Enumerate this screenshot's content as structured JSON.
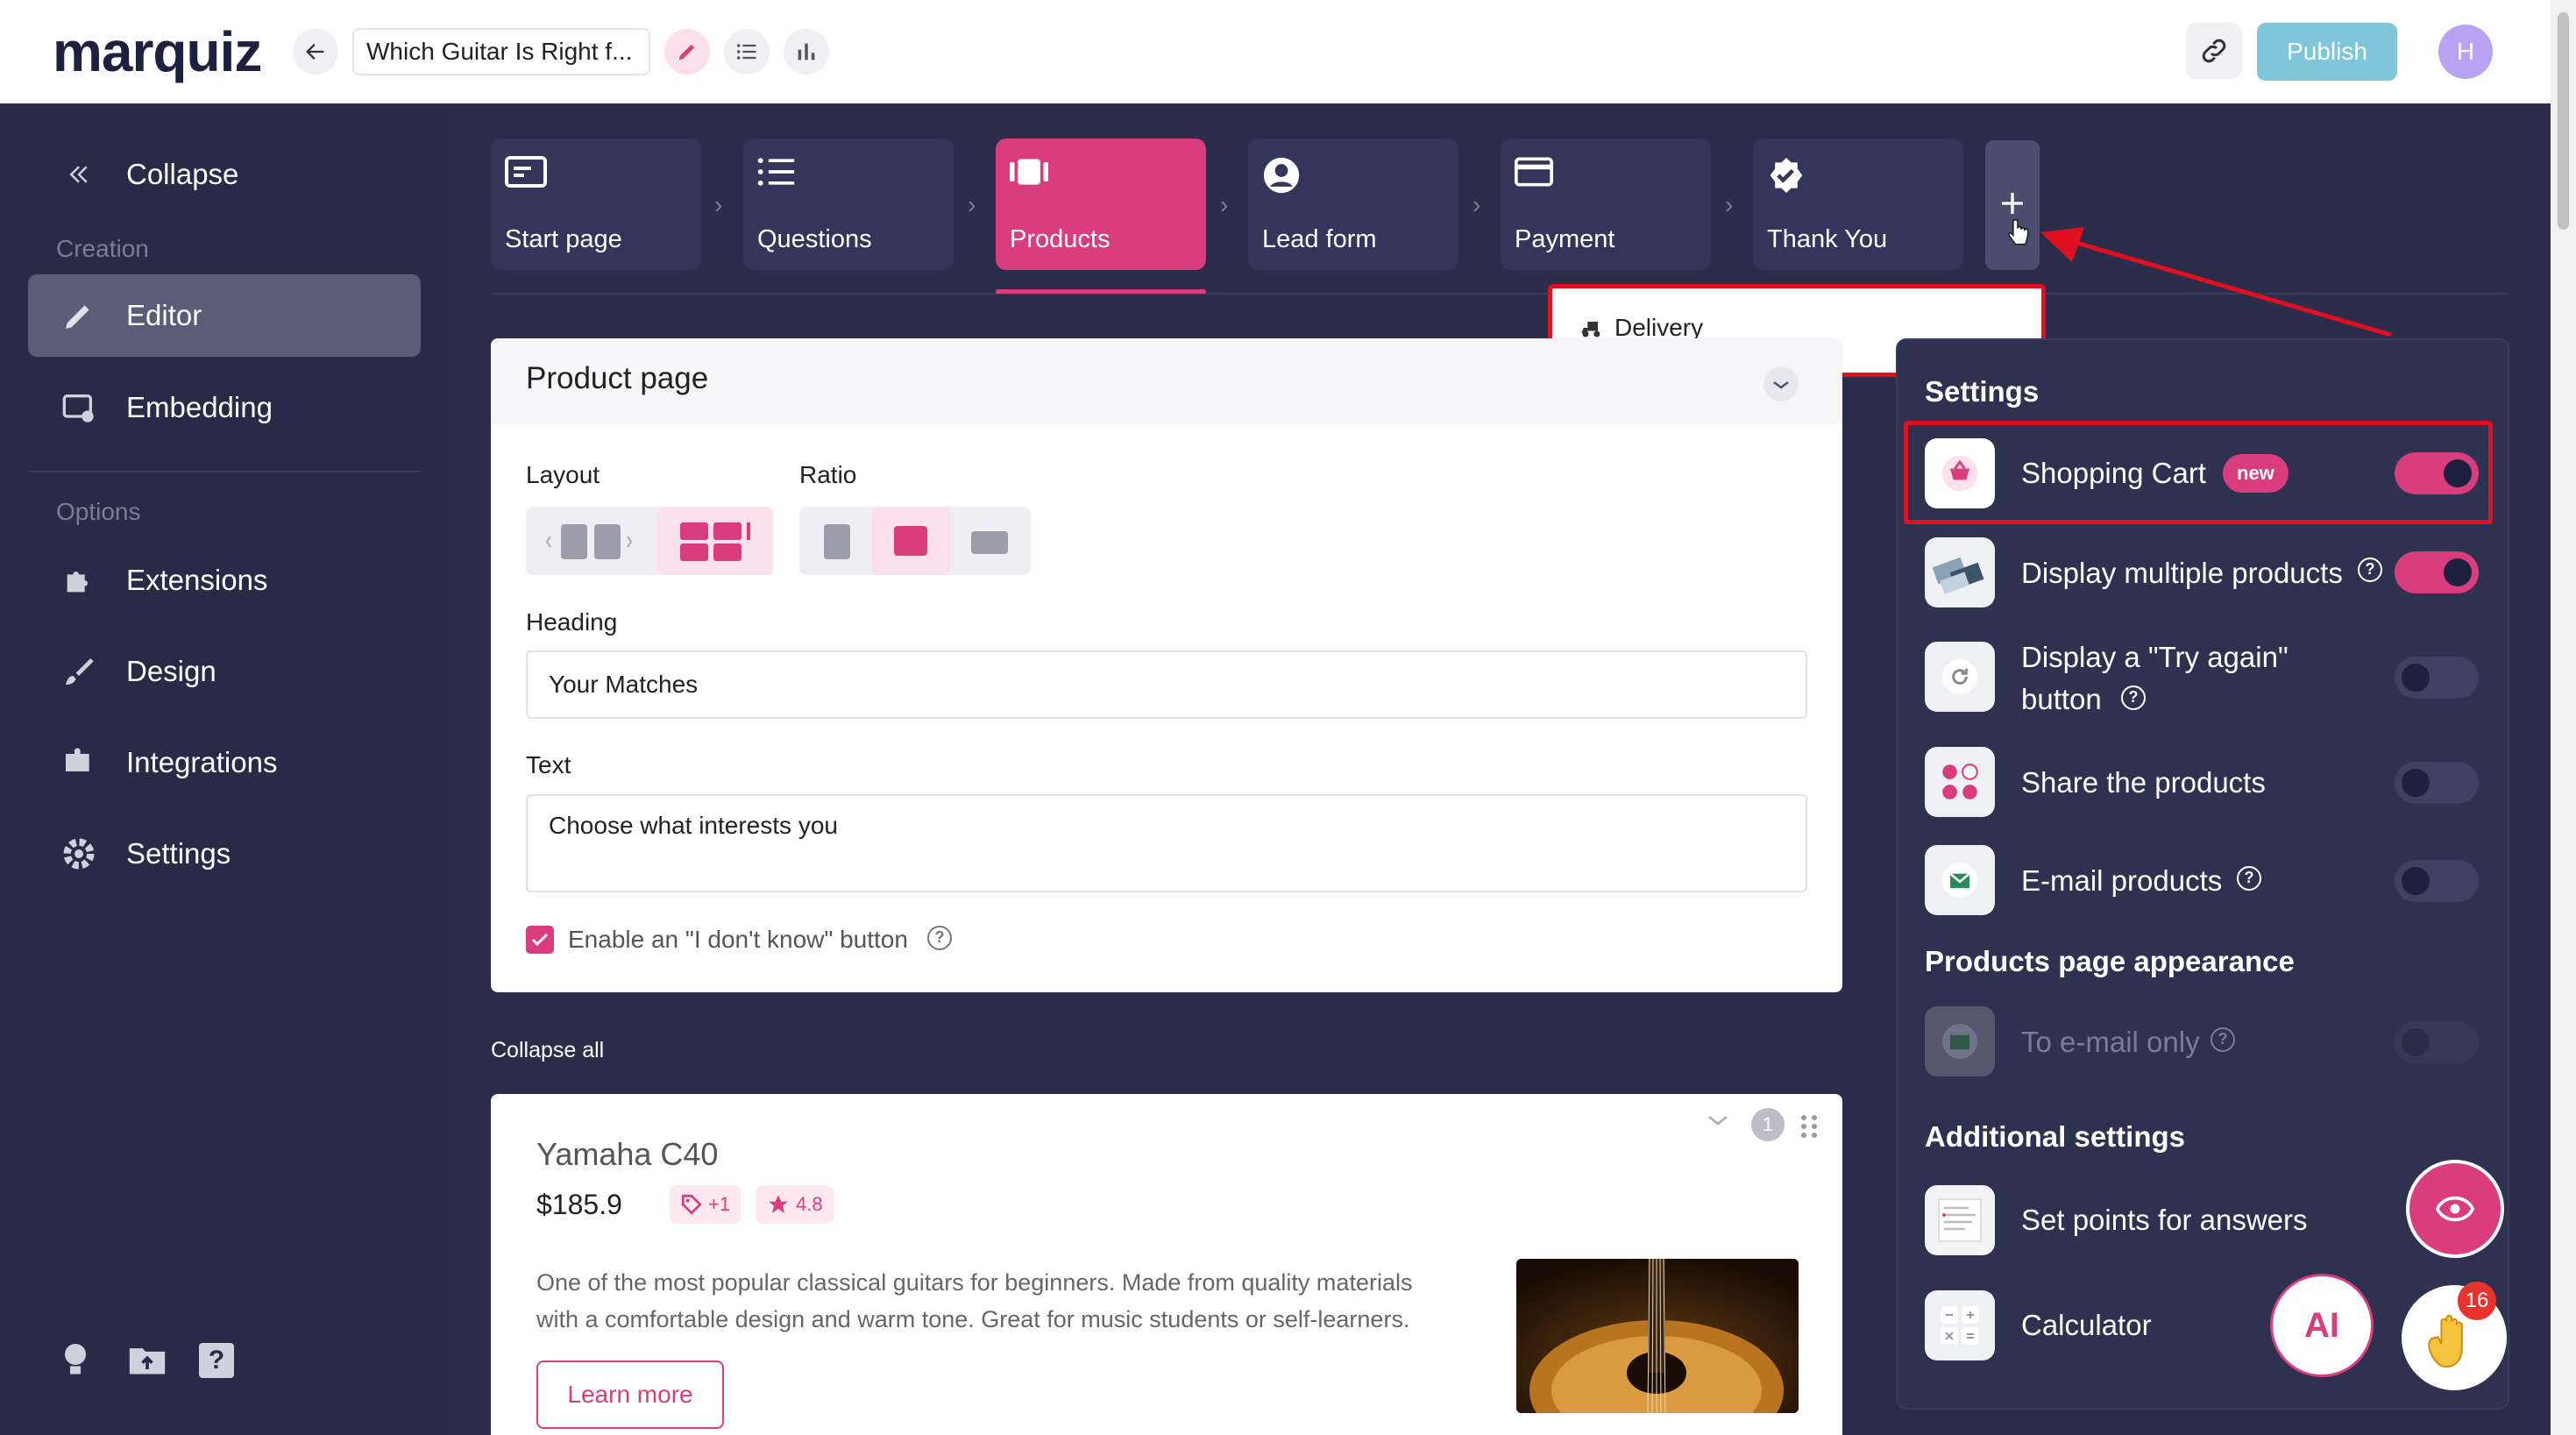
{
  "header": {
    "logo": "marquiz",
    "quiz_title": "Which Guitar Is Right f...",
    "publish_label": "Publish",
    "avatar_initial": "H"
  },
  "sidebar": {
    "collapse_label": "Collapse",
    "section_creation": "Creation",
    "section_options": "Options",
    "items": [
      {
        "label": "Editor"
      },
      {
        "label": "Embedding"
      },
      {
        "label": "Extensions"
      },
      {
        "label": "Design"
      },
      {
        "label": "Integrations"
      },
      {
        "label": "Settings"
      }
    ]
  },
  "tabs": [
    {
      "label": "Start page"
    },
    {
      "label": "Questions"
    },
    {
      "label": "Products"
    },
    {
      "label": "Lead form"
    },
    {
      "label": "Payment"
    },
    {
      "label": "Thank You"
    }
  ],
  "dropdown": {
    "delivery_label": "Delivery"
  },
  "product_page": {
    "title": "Product page",
    "layout_label": "Layout",
    "ratio_label": "Ratio",
    "heading_label": "Heading",
    "heading_value": "Your Matches",
    "text_label": "Text",
    "text_value": "Choose what interests you",
    "dont_know_label": "Enable an \"I don't know\" button"
  },
  "collapse_all": "Collapse all",
  "product": {
    "name": "Yamaha C40",
    "price": "$185.9",
    "tag_count": "+1",
    "rating": "4.8",
    "number": "1",
    "description_line1": "One of the most popular classical guitars for beginners. Made from quality materials",
    "description_line2": "with a comfortable design and warm tone. Great for music students or self-learners.",
    "learn_more": "Learn more"
  },
  "settings": {
    "title": "Settings",
    "shopping_cart": "Shopping Cart",
    "new_badge": "new",
    "display_multiple": "Display multiple products",
    "try_again_line1": "Display a \"Try again\"",
    "try_again_line2": "button",
    "share": "Share the products",
    "email_products": "E-mail products",
    "appearance_title": "Products page appearance",
    "email_only": "To e-mail only",
    "additional_title": "Additional settings",
    "points": "Set points for answers",
    "calculator": "Calculator"
  },
  "fab": {
    "ai_label": "AI",
    "notification_count": "16"
  },
  "colors": {
    "accent": "#d93d7e",
    "sidebar_bg": "#282a47",
    "main_bg": "#2b2d4a",
    "publish": "#7fc6da",
    "annotation_red": "#e01020"
  }
}
